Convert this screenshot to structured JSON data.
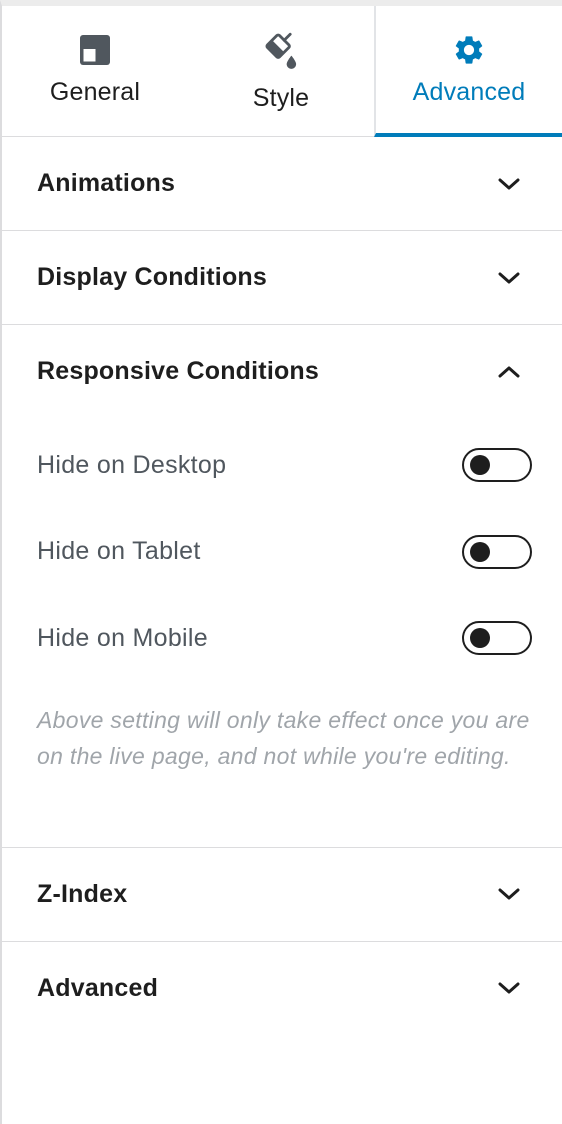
{
  "tabs": [
    {
      "label": "General",
      "icon": "layout-icon",
      "active": false
    },
    {
      "label": "Style",
      "icon": "paint-bucket-icon",
      "active": false
    },
    {
      "label": "Advanced",
      "icon": "gear-icon",
      "active": true
    }
  ],
  "accent_color": "#007cba",
  "sections": {
    "animations": {
      "title": "Animations",
      "expanded": false
    },
    "display_conditions": {
      "title": "Display Conditions",
      "expanded": false
    },
    "responsive_conditions": {
      "title": "Responsive Conditions",
      "expanded": true,
      "toggles": [
        {
          "label": "Hide on Desktop",
          "checked": false
        },
        {
          "label": "Hide on Tablet",
          "checked": false
        },
        {
          "label": "Hide on Mobile",
          "checked": false
        }
      ],
      "help_text": "Above setting will only take effect once you are on the live page, and not while you're editing."
    },
    "z_index": {
      "title": "Z-Index",
      "expanded": false
    },
    "advanced": {
      "title": "Advanced",
      "expanded": false
    }
  }
}
